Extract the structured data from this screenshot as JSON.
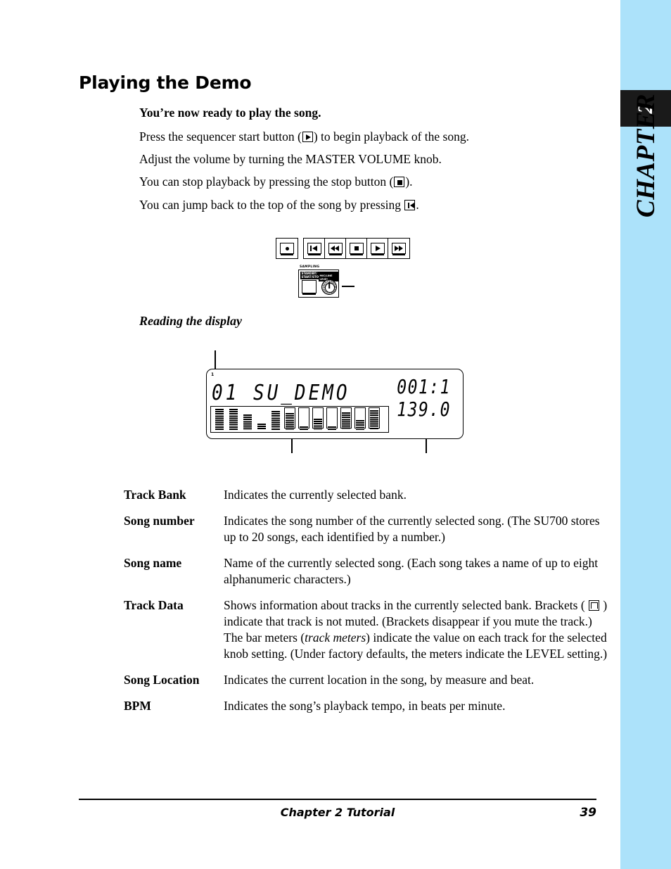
{
  "sidebar": {
    "chapter_number": "2",
    "chapter_word": "CHAPTER",
    "background_color": "#ace2fa",
    "tab_color": "#1a1a1a"
  },
  "heading": {
    "title": "Playing the Demo",
    "lead": "You’re now ready to play the song."
  },
  "paragraphs": {
    "p1_before": "Press the sequencer start button (",
    "p1_after": ") to begin playback of the song.",
    "p2": "Adjust the volume by turning the MASTER VOLUME knob.",
    "p3_before": "You can stop playback by pressing the stop button (",
    "p3_after": ").",
    "p4_before": "You can jump back to the top of the song by pressing ",
    "p4_after": "."
  },
  "transport": {
    "record_label": "record-button",
    "buttons": [
      {
        "name": "top",
        "label": "jump-to-top-button"
      },
      {
        "name": "rew",
        "label": "rewind-button"
      },
      {
        "name": "stop",
        "label": "stop-button"
      },
      {
        "name": "play",
        "label": "play-button"
      },
      {
        "name": "ff",
        "label": "fast-forward-button"
      }
    ]
  },
  "sampling_panel": {
    "title": "SAMPLING",
    "standby_label": "STANDBY/\nSTART/STOP",
    "mic_label": "MIC/LINE LEVEL"
  },
  "display_section": {
    "heading": "Reading the display"
  },
  "lcd": {
    "bank_indicator": "1",
    "main_text": "01 SU_DEMO",
    "song_location": "001:1",
    "bpm": "139.0",
    "track_meters": [
      {
        "level": 30,
        "bracket": false
      },
      {
        "level": 30,
        "bracket": false
      },
      {
        "level": 22,
        "bracket": false
      },
      {
        "level": 9,
        "bracket": false
      },
      {
        "level": 27,
        "bracket": false
      },
      {
        "level": 24,
        "bracket": true
      },
      {
        "level": 5,
        "bracket": true
      },
      {
        "level": 16,
        "bracket": true
      },
      {
        "level": 5,
        "bracket": true
      },
      {
        "level": 25,
        "bracket": true
      },
      {
        "level": 14,
        "bracket": true
      },
      {
        "level": 28,
        "bracket": true
      }
    ]
  },
  "definitions": [
    {
      "term": "Track Bank",
      "desc": "Indicates the currently selected bank."
    },
    {
      "term": "Song number",
      "desc": "Indicates the song number of the currently selected song. (The SU700 stores up to 20 songs, each identified by a number.)"
    },
    {
      "term": "Song name",
      "desc": "Name of the currently selected song. (Each song takes a name of up to eight alphanumeric characters.)"
    },
    {
      "term": "Track Data",
      "desc_1": "Shows information about tracks in the currently selected bank. Brackets ( ",
      "desc_2": " ) indicate that track is not muted. (Brackets disappear if you mute the track.) The bar meters (",
      "desc_em": "track meters",
      "desc_3": ") indicate the value on each track for the selected knob setting. (Under factory defaults, the meters indicate the LEVEL setting.)"
    },
    {
      "term": "Song Location",
      "desc": "Indicates the current location in the song, by measure and beat."
    },
    {
      "term": "BPM",
      "desc": "Indicates the song’s playback tempo, in beats per minute."
    }
  ],
  "footer": {
    "center": "Chapter 2   Tutorial",
    "page_number": "39"
  }
}
